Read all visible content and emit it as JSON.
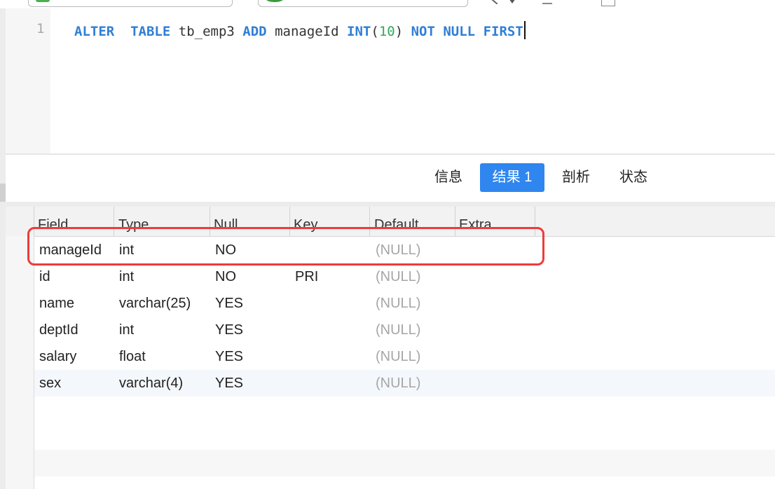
{
  "editor": {
    "line_number": "1",
    "tokens": {
      "alter": "ALTER",
      "table": "TABLE",
      "table_name": "tb_emp3",
      "add": "ADD",
      "column": "manageId",
      "int": "INT",
      "paren_open": "(",
      "size": "10",
      "paren_close": ")",
      "not_null": "NOT NULL",
      "first": "FIRST"
    }
  },
  "tabs": [
    {
      "label": "信息",
      "active": false
    },
    {
      "label": "结果 1",
      "active": true
    },
    {
      "label": "剖析",
      "active": false
    },
    {
      "label": "状态",
      "active": false
    }
  ],
  "grid": {
    "columns": [
      "Field",
      "Type",
      "Null",
      "Key",
      "Default",
      "Extra"
    ],
    "rows": [
      [
        "manageId",
        "int",
        "NO",
        "",
        "(NULL)",
        ""
      ],
      [
        "id",
        "int",
        "NO",
        "PRI",
        "(NULL)",
        ""
      ],
      [
        "name",
        "varchar(25)",
        "YES",
        "",
        "(NULL)",
        ""
      ],
      [
        "deptId",
        "int",
        "YES",
        "",
        "(NULL)",
        ""
      ],
      [
        "salary",
        "float",
        "YES",
        "",
        "(NULL)",
        ""
      ],
      [
        "sex",
        "varchar(4)",
        "YES",
        "",
        "(NULL)",
        ""
      ]
    ],
    "highlighted_row_index": 0
  },
  "colors": {
    "keyword": "#2f7fd6",
    "number": "#2fa85a",
    "active_tab": "#2f86ef",
    "highlight": "#ee3b3b",
    "null_text": "#a6a6a6"
  }
}
